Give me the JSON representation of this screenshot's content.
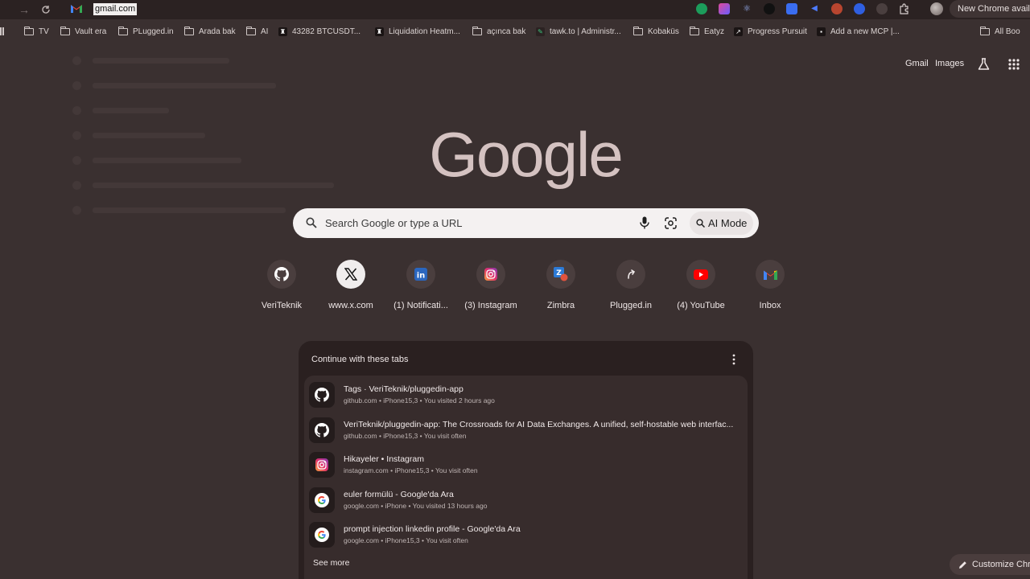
{
  "browser": {
    "address_bar": {
      "url": "gmail.com"
    },
    "update_button": {
      "label": "New Chrome avail"
    },
    "bookmarks": [
      {
        "label": "TV",
        "icon": "folder-icon"
      },
      {
        "label": "Vault era",
        "icon": "folder-icon"
      },
      {
        "label": "PLugged.in",
        "icon": "folder-icon"
      },
      {
        "label": "Arada bak",
        "icon": "folder-icon"
      },
      {
        "label": "AI",
        "icon": "folder-icon"
      },
      {
        "label": "43282 BTCUSDT...",
        "icon": "site-icon"
      },
      {
        "label": "Liquidation Heatm...",
        "icon": "site-icon"
      },
      {
        "label": "açınca bak",
        "icon": "folder-icon"
      },
      {
        "label": "tawk.to | Administr...",
        "icon": "site-icon"
      },
      {
        "label": "Kobaküs",
        "icon": "folder-icon"
      },
      {
        "label": "Eatyz",
        "icon": "folder-icon"
      },
      {
        "label": "Progress Pursuit",
        "icon": "site-icon"
      },
      {
        "label": "Add a new MCP |...",
        "icon": "site-icon"
      },
      {
        "label": "All Boo",
        "icon": "folder-icon"
      }
    ]
  },
  "header": {
    "gmail_link": "Gmail",
    "images_link": "Images"
  },
  "logo": {
    "text": "Google"
  },
  "search": {
    "placeholder": "Search Google or type a URL",
    "ai_mode_label": "AI Mode"
  },
  "shortcuts": [
    {
      "label": "VeriTeknik",
      "icon": "github-icon"
    },
    {
      "label": "www.x.com",
      "icon": "x-icon"
    },
    {
      "label": "(1) Notificati...",
      "icon": "linkedin-icon"
    },
    {
      "label": "(3) Instagram",
      "icon": "instagram-icon"
    },
    {
      "label": "Zimbra",
      "icon": "zimbra-icon"
    },
    {
      "label": "Plugged.in",
      "icon": "pluggedin-icon"
    },
    {
      "label": "(4) YouTube",
      "icon": "youtube-icon"
    },
    {
      "label": "Inbox",
      "icon": "gmail-icon"
    }
  ],
  "continue_tabs": {
    "title": "Continue with these tabs",
    "items": [
      {
        "title": "Tags · VeriTeknik/pluggedin-app",
        "meta": "github.com • iPhone15,3 • You visited 2 hours ago",
        "icon": "github-icon"
      },
      {
        "title": "VeriTeknik/pluggedin-app: The Crossroads for AI Data Exchanges. A unified, self-hostable web interfac...",
        "meta": "github.com • iPhone15,3 • You visit often",
        "icon": "github-icon"
      },
      {
        "title": "Hikayeler • Instagram",
        "meta": "instagram.com • iPhone15,3 • You visit often",
        "icon": "instagram-icon"
      },
      {
        "title": "euler formülü - Google'da Ara",
        "meta": "google.com • iPhone • You visited 13 hours ago",
        "icon": "google-icon"
      },
      {
        "title": "prompt injection linkedin profile - Google'da Ara",
        "meta": "google.com • iPhone15,3 • You visit often",
        "icon": "google-icon"
      }
    ],
    "see_more": "See more"
  },
  "customize": {
    "label": "Customize Chro"
  },
  "colors": {
    "background": "#3a3030",
    "logo": "#d4c2c1",
    "card": "#2a2020",
    "searchbox": "#f4f1f1"
  }
}
